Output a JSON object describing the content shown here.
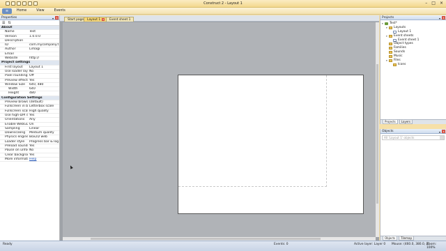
{
  "window": {
    "title": "Construct 2 - Layout 1"
  },
  "ribbon": {
    "file_label": "≡",
    "tabs": [
      "Home",
      "View",
      "Events"
    ]
  },
  "properties": {
    "title": "Properties",
    "close_label": "x",
    "rows": [
      {
        "type": "section",
        "key": "About"
      },
      {
        "type": "row",
        "key": "Name",
        "value": "Test"
      },
      {
        "type": "row",
        "key": "Version",
        "value": "1.0.0.0"
      },
      {
        "type": "row",
        "key": "Description",
        "value": ""
      },
      {
        "type": "row",
        "key": "ID",
        "value": "com.mycompany.test"
      },
      {
        "type": "row",
        "key": "Author",
        "value": "Limagi"
      },
      {
        "type": "row",
        "key": "Email",
        "value": ""
      },
      {
        "type": "row",
        "key": "Website",
        "value": "http://"
      },
      {
        "type": "section",
        "key": "Project settings"
      },
      {
        "type": "row",
        "key": "First layout",
        "value": "Layout 1"
      },
      {
        "type": "row",
        "key": "Use loader layout",
        "value": "No"
      },
      {
        "type": "row",
        "key": "Pixel rounding",
        "value": "Off"
      },
      {
        "type": "row",
        "key": "Preview effects",
        "value": "Yes"
      },
      {
        "type": "row",
        "key": "Window Size",
        "value": "640, 480"
      },
      {
        "type": "subrow",
        "key": "Width",
        "value": "640"
      },
      {
        "type": "subrow",
        "key": "Height",
        "value": "480"
      },
      {
        "type": "section",
        "key": "Configuration Settings"
      },
      {
        "type": "row",
        "key": "Preview browser",
        "value": "(default)"
      },
      {
        "type": "row",
        "key": "Fullscreen in brow...",
        "value": "Letterbox scale"
      },
      {
        "type": "row",
        "key": "Fullscreen scaling",
        "value": "High quality"
      },
      {
        "type": "row",
        "key": "Use high-DPI dis...",
        "value": "Yes"
      },
      {
        "type": "row",
        "key": "Orientations",
        "value": "Any"
      },
      {
        "type": "row",
        "key": "Enable WebGL",
        "value": "On"
      },
      {
        "type": "row",
        "key": "Sampling",
        "value": "Linear"
      },
      {
        "type": "row",
        "key": "Downscaling",
        "value": "Medium quality"
      },
      {
        "type": "row",
        "key": "Physics engine",
        "value": "Box2D web"
      },
      {
        "type": "row",
        "key": "Loader style",
        "value": "Progress bar & logo"
      },
      {
        "type": "row",
        "key": "Preload sounds",
        "value": "Yes"
      },
      {
        "type": "row",
        "key": "Pause on unfocus",
        "value": "No"
      },
      {
        "type": "row",
        "key": "Clear background",
        "value": "Yes"
      },
      {
        "type": "row",
        "key": "More information",
        "value": "Help",
        "link": true
      }
    ]
  },
  "editor": {
    "tabs": [
      {
        "label": "Start page",
        "active": false,
        "closable": false
      },
      {
        "label": "Layout 1",
        "active": true,
        "closable": true
      },
      {
        "label": "Event sheet 1",
        "active": false,
        "closable": false
      }
    ],
    "close_label": "x"
  },
  "projects": {
    "title": "Projects",
    "close_label": "x",
    "tree": [
      {
        "label": "Test*",
        "level": 0,
        "icon": "project-icon",
        "kind": "proj",
        "expanded": true
      },
      {
        "label": "Layouts",
        "level": 1,
        "icon": "folder-icon",
        "kind": "folder",
        "expanded": true
      },
      {
        "label": "Layout 1",
        "level": 2,
        "icon": "layout-icon",
        "kind": "doc"
      },
      {
        "label": "Event sheets",
        "level": 1,
        "icon": "folder-icon",
        "kind": "folder",
        "expanded": true
      },
      {
        "label": "Event sheet 1",
        "level": 2,
        "icon": "event-sheet-icon",
        "kind": "doc"
      },
      {
        "label": "Object types",
        "level": 1,
        "icon": "folder-icon",
        "kind": "folder"
      },
      {
        "label": "Families",
        "level": 1,
        "icon": "folder-icon",
        "kind": "folder"
      },
      {
        "label": "Sounds",
        "level": 1,
        "icon": "folder-icon",
        "kind": "folder"
      },
      {
        "label": "Music",
        "level": 1,
        "icon": "folder-icon",
        "kind": "folder"
      },
      {
        "label": "Files",
        "level": 1,
        "icon": "folder-icon",
        "kind": "folder",
        "expanded": true
      },
      {
        "label": "Icons",
        "level": 2,
        "icon": "folder-icon",
        "kind": "folder"
      }
    ],
    "tabs": [
      "Projects",
      "Layers"
    ]
  },
  "objects": {
    "title": "Objects",
    "close_label": "x",
    "filter_placeholder": "All 'Layout 1' objects",
    "tabs": [
      "Objects",
      "Tilemap"
    ]
  },
  "status": {
    "left": "Ready",
    "events": "Events: 0",
    "layer": "Active layer: Layer 0",
    "mouse": "Mouse: (460.0, 380.0, 0)",
    "zoom": "Zoom: 100%"
  }
}
